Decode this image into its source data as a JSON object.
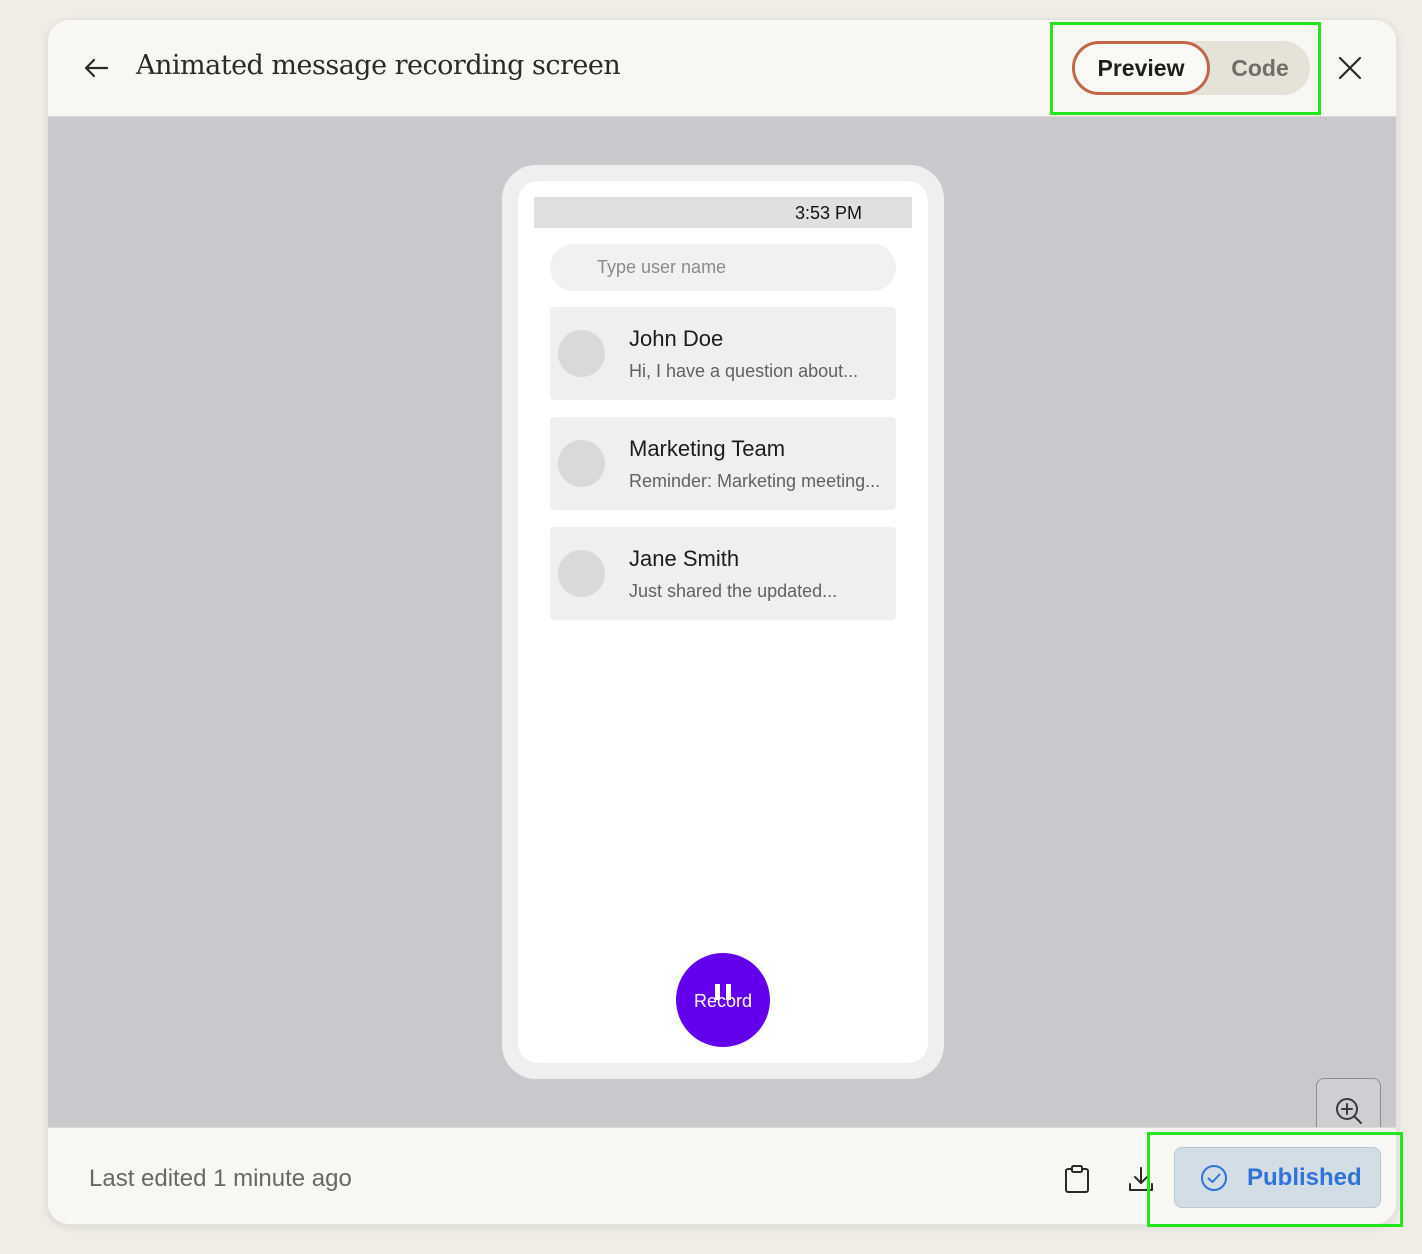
{
  "header": {
    "title": "Animated message recording screen",
    "tabs": [
      {
        "label": "Preview",
        "active": true
      },
      {
        "label": "Code",
        "active": false
      }
    ],
    "icons": {
      "back": "arrow-left-icon",
      "close": "close-icon"
    }
  },
  "phone": {
    "status_time": "3:53 PM",
    "search_placeholder": "Type user name",
    "conversations": [
      {
        "name": "John Doe",
        "preview": "Hi, I have a question about..."
      },
      {
        "name": "Marketing Team",
        "preview": "Reminder: Marketing meeting..."
      },
      {
        "name": "Jane Smith",
        "preview": "Just shared the updated..."
      }
    ],
    "record_label": "Record",
    "accent_color": "#6200ee"
  },
  "zoom": {
    "in_icon": "zoom-in-icon",
    "out_icon": "zoom-out-icon"
  },
  "footer": {
    "last_edited": "Last edited 1 minute ago",
    "icons": {
      "copy": "clipboard-icon",
      "download": "download-icon",
      "status": "check-circle-icon"
    },
    "published_label": "Published",
    "published_color": "#2f73d9"
  },
  "annotations": {
    "highlight_color": "#22e51d"
  }
}
